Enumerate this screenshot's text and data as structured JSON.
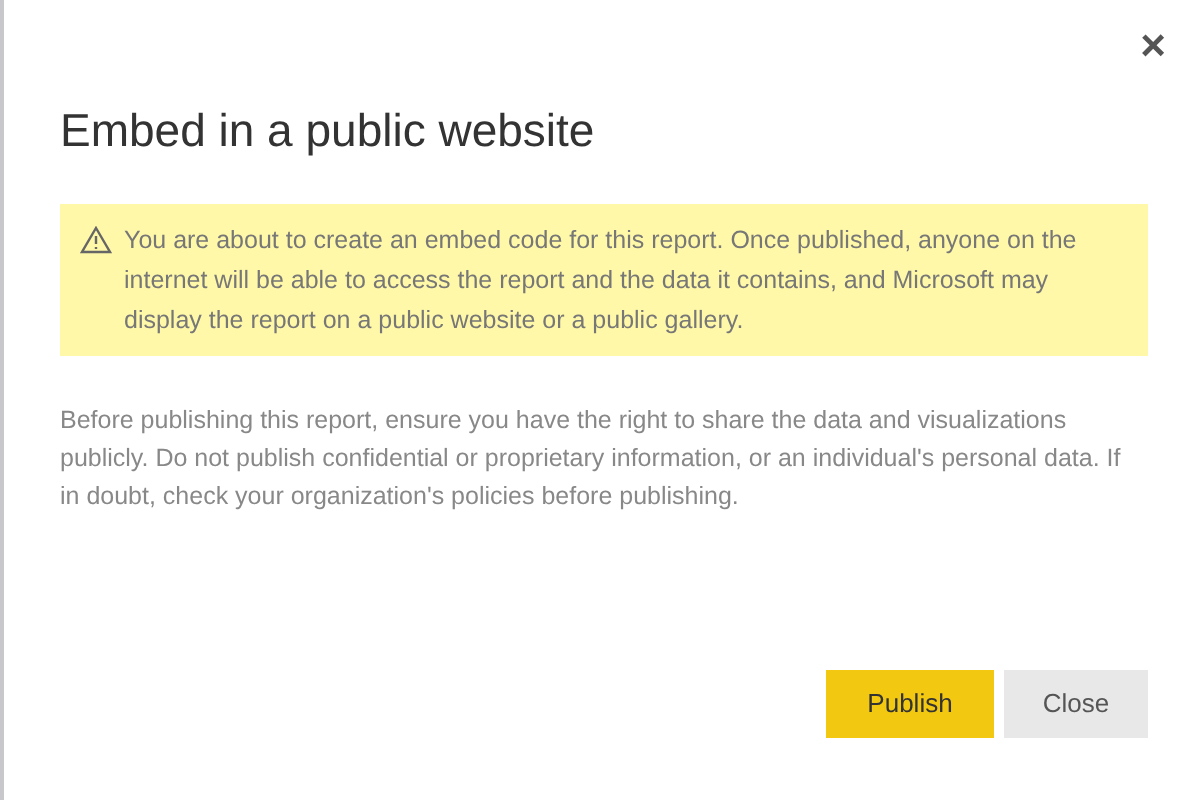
{
  "dialog": {
    "title": "Embed in a public website",
    "close_glyph": "×",
    "warning": "You are about to create an embed code for this report. Once published, anyone on the internet will be able to access the report and the data it contains, and Microsoft may display the report on a public website or a public gallery.",
    "body": "Before publishing this report, ensure you have the right to share the data and visualizations publicly. Do not publish confidential or proprietary information, or an individual's personal data. If in doubt, check your organization's policies before publishing.",
    "buttons": [
      {
        "label": "Publish",
        "kind": "primary"
      },
      {
        "label": "Close",
        "kind": "secondary"
      }
    ]
  }
}
